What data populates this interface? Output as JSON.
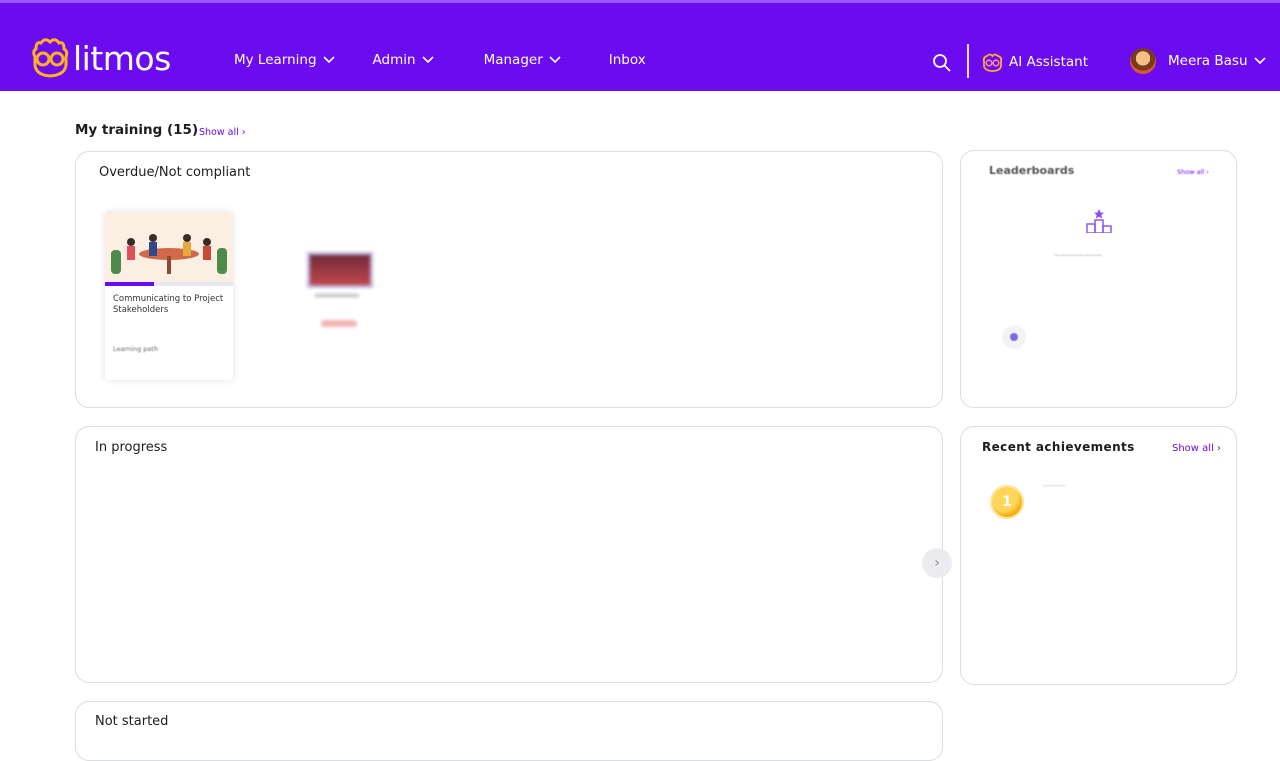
{
  "header": {
    "brand": "litmos",
    "nav": [
      {
        "label": "My Learning",
        "has_menu": true
      },
      {
        "label": "Admin",
        "has_menu": true
      },
      {
        "label": "Manager",
        "has_menu": true
      },
      {
        "label": "Inbox",
        "has_menu": false
      }
    ],
    "ai_assistant_label": "AI Assistant",
    "user_name": "Meera Basu",
    "icons": {
      "search": "search-icon",
      "ai": "ai-assistant-icon",
      "logo": "litmos-logo-icon"
    }
  },
  "training": {
    "title": "My training (15)",
    "show_all": "Show all"
  },
  "overdue": {
    "title": "Overdue/Not compliant",
    "courses": [
      {
        "name": "Communicating to Project Stakeholders",
        "type": "Learning path",
        "progress_pct": 38
      }
    ]
  },
  "leaderboards": {
    "title": "Leaderboards",
    "show_all": "Show all"
  },
  "in_progress": {
    "title": "In progress"
  },
  "achievements": {
    "title": "Recent achievements",
    "show_all": "Show all",
    "badge_value": "1"
  },
  "not_started": {
    "title": "Not started"
  },
  "colors": {
    "brand": "#6a0bf0",
    "link": "#6a0bf0",
    "overdue": "#e0484e",
    "coin": "#f0a400"
  }
}
